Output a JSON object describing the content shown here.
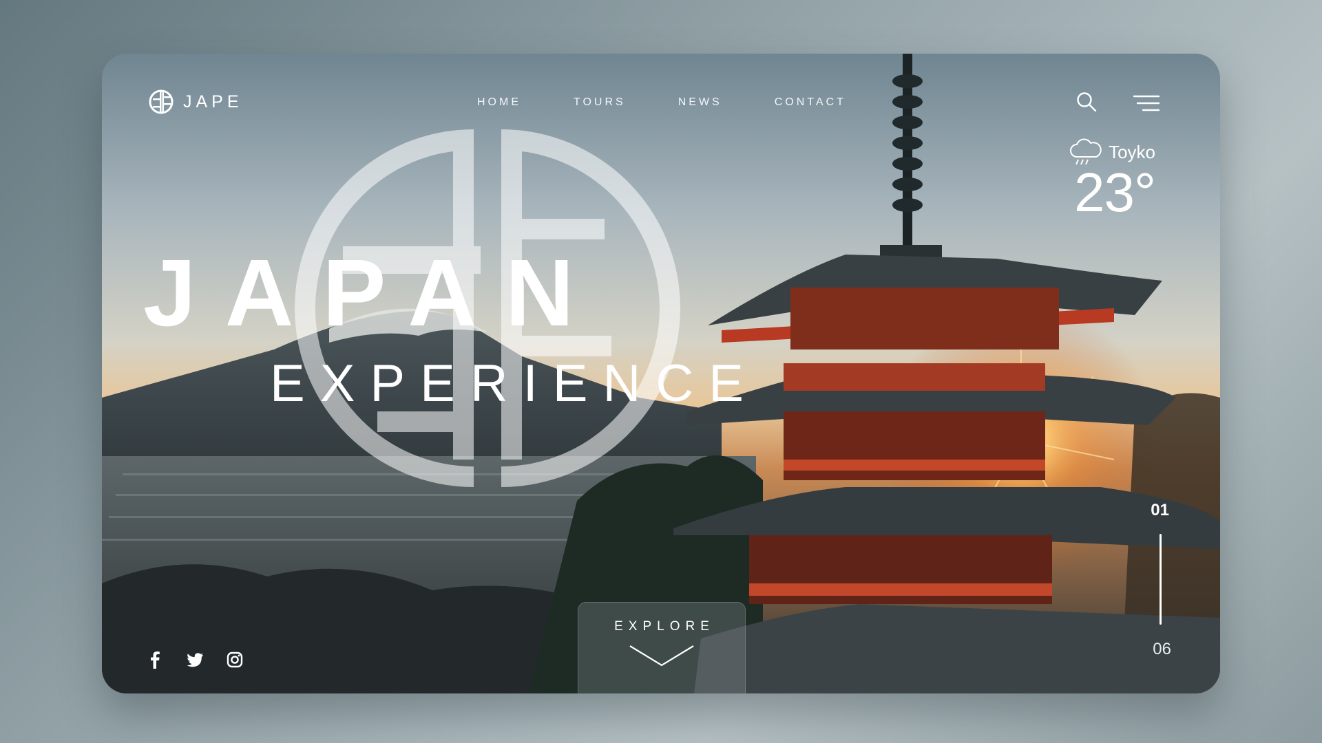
{
  "brand": {
    "name": "JAPE"
  },
  "nav": {
    "items": [
      "HOME",
      "TOURS",
      "NEWS",
      "CONTACT"
    ]
  },
  "icons": {
    "search": "search-icon",
    "menu": "menu-icon",
    "weather": "rain-cloud-icon",
    "facebook": "facebook-icon",
    "twitter": "twitter-icon",
    "instagram": "instagram-icon"
  },
  "weather": {
    "city": "Toyko",
    "temperature": "23°"
  },
  "hero": {
    "title": "JAPAN",
    "subtitle": "EXPERIENCE"
  },
  "pager": {
    "current": "01",
    "total": "06"
  },
  "explore": {
    "label": "EXPLORE"
  },
  "colors": {
    "accent_white": "#ffffff",
    "pagoda_red": "#b83a22",
    "sun": "#ffb347"
  }
}
